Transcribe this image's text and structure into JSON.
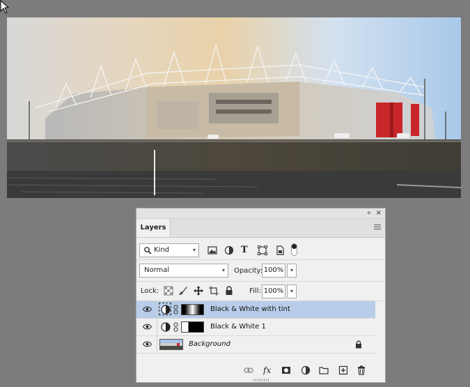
{
  "panel": {
    "tab_label": "Layers",
    "filter_kind": "Kind",
    "blend_mode": "Normal",
    "opacity_label": "Opacity:",
    "opacity_value": "100%",
    "lock_label": "Lock:",
    "fill_label": "Fill:",
    "fill_value": "100%"
  },
  "layers": [
    {
      "name": "Black & White with tint",
      "type": "adjustment",
      "selected": true
    },
    {
      "name": "Black & White 1",
      "type": "adjustment",
      "selected": false
    },
    {
      "name": "Background",
      "type": "image",
      "selected": false,
      "locked": true
    }
  ],
  "colors": {
    "selection": "#b8cde9",
    "panel_bg": "#f0f0f0",
    "workspace": "#7c7c7c",
    "tint": "#e2c79a"
  }
}
